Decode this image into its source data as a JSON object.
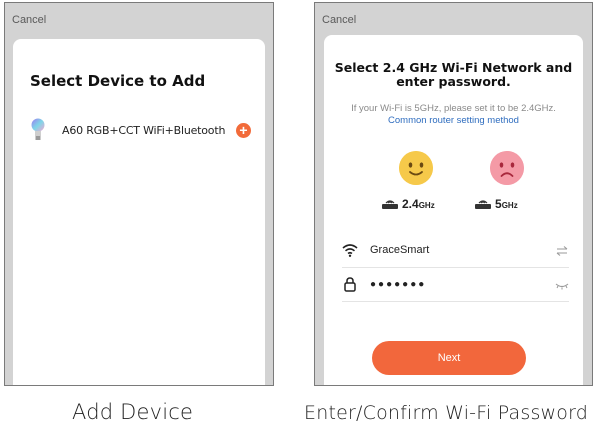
{
  "screen_add": {
    "cancel": "Cancel",
    "title": "Select Device to Add",
    "device": {
      "name": "A60 RGB+CCT WiFi+Bluetooth",
      "icon": "bulb-icon",
      "action_icon": "plus-icon"
    }
  },
  "screen_wifi": {
    "cancel": "Cancel",
    "title_line1": "Select 2.4 GHz Wi-Fi Network and",
    "title_line2": "enter password.",
    "hint": "If your Wi-Fi is 5GHz, please set it to be 2.4GHz.",
    "link": "Common router setting method",
    "band_ok": {
      "value": "2.4",
      "unit": "GHz",
      "icon": "smile-face-icon"
    },
    "band_bad": {
      "value": "5",
      "unit": "GHz",
      "icon": "sad-face-icon"
    },
    "ssid": "GraceSmart",
    "password": "●●●●●●●",
    "next": "Next"
  },
  "captions": {
    "left": "Add Device",
    "right": "Enter/Confirm Wi-Fi Password"
  },
  "colors": {
    "accent": "#f2673c",
    "link": "#2f6dbf",
    "face_ok": "#f6c94a",
    "face_bad": "#f49aa6"
  }
}
